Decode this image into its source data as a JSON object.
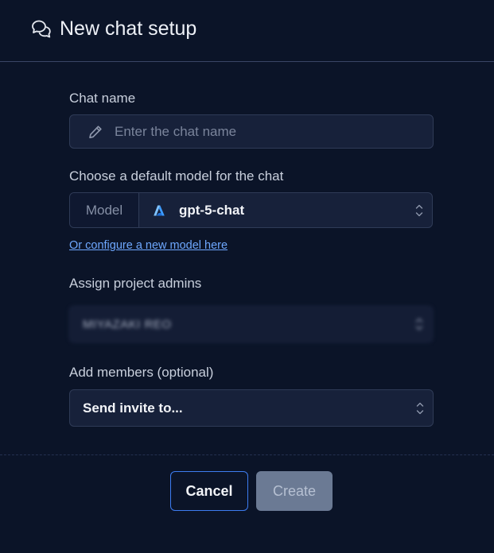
{
  "dialog": {
    "title": "New chat setup"
  },
  "chat_name": {
    "label": "Chat name",
    "placeholder": "Enter the chat name",
    "value": ""
  },
  "model": {
    "label": "Choose a default model for the chat",
    "addon_label": "Model",
    "selected_value": "gpt-5-chat",
    "icon": "azure-icon",
    "configure_link": "Or configure a new model here"
  },
  "admins": {
    "label": "Assign project admins",
    "selected_value": "MIYAZAKI REO"
  },
  "members": {
    "label": "Add members (optional)",
    "selected_value": "Send invite to..."
  },
  "actions": {
    "cancel_label": "Cancel",
    "create_label": "Create"
  },
  "colors": {
    "background": "#0b1428",
    "field_bg": "#17213a",
    "accent": "#3d7cf0",
    "link": "#6ea8ff",
    "disabled_button": "#6b7a94"
  }
}
